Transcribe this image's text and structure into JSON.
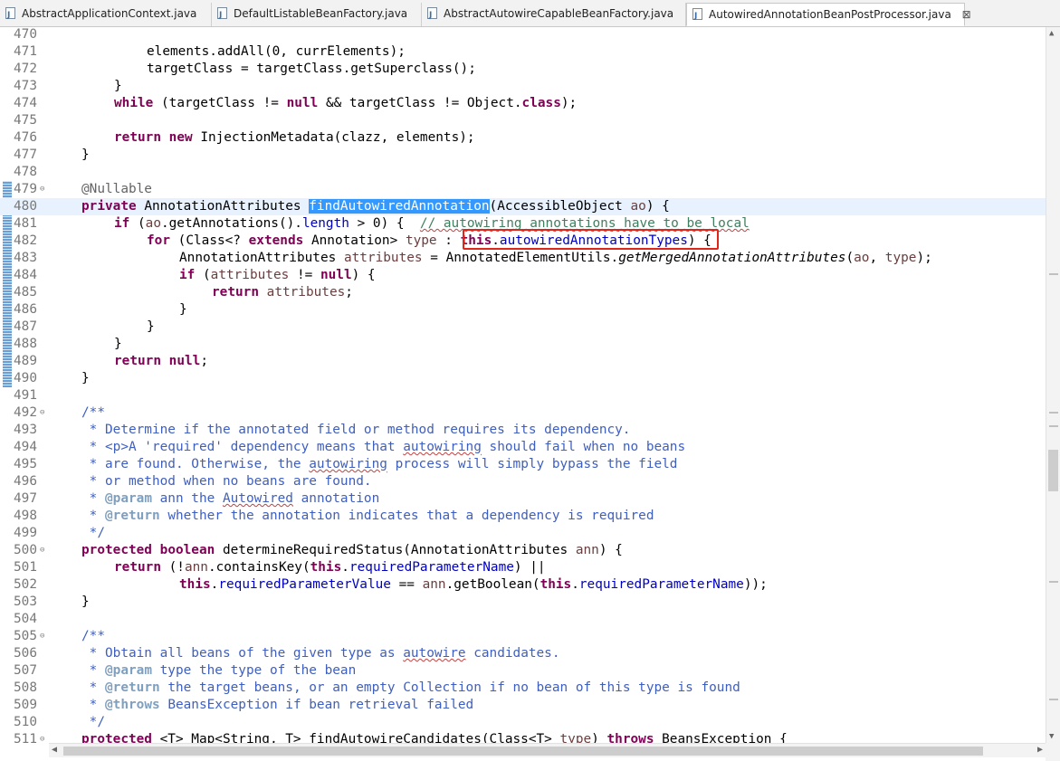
{
  "tabs": [
    {
      "label": "AbstractApplicationContext.java",
      "active": false
    },
    {
      "label": "DefaultListableBeanFactory.java",
      "active": false
    },
    {
      "label": "AbstractAutowireCapableBeanFactory.java",
      "active": false
    },
    {
      "label": "AutowiredAnnotationBeanPostProcessor.java",
      "active": true
    }
  ],
  "tab_close_glyph": "⊠",
  "line_numbers": [
    "470",
    "471",
    "472",
    "473",
    "474",
    "475",
    "476",
    "477",
    "478",
    "479",
    "480",
    "481",
    "482",
    "483",
    "484",
    "485",
    "486",
    "487",
    "488",
    "489",
    "490",
    "491",
    "492",
    "493",
    "494",
    "495",
    "496",
    "497",
    "498",
    "499",
    "500",
    "501",
    "502",
    "503",
    "504",
    "505",
    "506",
    "507",
    "508",
    "509",
    "510",
    "511"
  ],
  "code": {
    "l471": [
      "elements.addAll(0, currElements);"
    ],
    "l472": [
      "targetClass = targetClass.getSuperclass();"
    ],
    "l473": [
      "}"
    ],
    "l474": [
      "while",
      " (targetClass != ",
      "null",
      " && targetClass != Object.",
      "class",
      ");"
    ],
    "l476": [
      "return",
      " ",
      "new",
      " InjectionMetadata(clazz, elements);"
    ],
    "l477": [
      "}"
    ],
    "l479": [
      "@Nullable"
    ],
    "l480": [
      "private",
      " AnnotationAttributes ",
      "findAutowiredAnnotation",
      "(AccessibleObject ",
      "ao",
      ") {"
    ],
    "l481": [
      "if",
      " (",
      "ao",
      ".getAnnotations().",
      "length",
      " > 0) {  ",
      "// autowiring annotations have to be local"
    ],
    "l482": [
      "for",
      " (Class<? ",
      "extends",
      " Annotation> ",
      "type",
      " : ",
      "this",
      ".",
      "autowiredAnnotationTypes",
      ") {"
    ],
    "l483": [
      "AnnotationAttributes ",
      "attributes",
      " = AnnotatedElementUtils.",
      "getMergedAnnotationAttributes",
      "(",
      "ao",
      ", ",
      "type",
      ");"
    ],
    "l484": [
      "if",
      " (",
      "attributes",
      " != ",
      "null",
      ") {"
    ],
    "l485": [
      "return",
      " ",
      "attributes",
      ";"
    ],
    "l486": [
      "}"
    ],
    "l487": [
      "}"
    ],
    "l488": [
      "}"
    ],
    "l489": [
      "return",
      " ",
      "null",
      ";"
    ],
    "l490": [
      "}"
    ],
    "l492": [
      "/**"
    ],
    "l493": [
      " * Determine if the annotated field or method requires its dependency."
    ],
    "l494": [
      " * <p>A 'required' dependency means that ",
      "autowiring",
      " should fail when no beans"
    ],
    "l495": [
      " * are found. Otherwise, the ",
      "autowiring",
      " process will simply bypass the field"
    ],
    "l496": [
      " * or method when no beans are found."
    ],
    "l497": [
      " * ",
      "@param",
      " ann the ",
      "Autowired",
      " annotation"
    ],
    "l498": [
      " * ",
      "@return",
      " whether the annotation indicates that a dependency is required"
    ],
    "l499": [
      " */"
    ],
    "l500": [
      "protected",
      " ",
      "boolean",
      " determineRequiredStatus(AnnotationAttributes ",
      "ann",
      ") {"
    ],
    "l501": [
      "return",
      " (!",
      "ann",
      ".containsKey(",
      "this",
      ".",
      "requiredParameterName",
      ") ||"
    ],
    "l502": [
      "this",
      ".",
      "requiredParameterValue",
      " == ",
      "ann",
      ".getBoolean(",
      "this",
      ".",
      "requiredParameterName",
      "));"
    ],
    "l503": [
      "}"
    ],
    "l505": [
      "/**"
    ],
    "l506": [
      " * Obtain all beans of the given type as ",
      "autowire",
      " candidates."
    ],
    "l507": [
      " * ",
      "@param",
      " type the type of the bean"
    ],
    "l508": [
      " * ",
      "@return",
      " the target beans, or an empty Collection if no bean of this type is found"
    ],
    "l509": [
      " * ",
      "@throws",
      " BeansException if bean retrieval failed"
    ],
    "l510": [
      " */"
    ],
    "l511": [
      "protected",
      " <T> Map<String, T> findAutowireCandidates(Class<T> ",
      "type",
      ") ",
      "throws",
      " BeansException {"
    ]
  },
  "fold_marker": "⊖",
  "colors": {
    "keyword": "#7f0055",
    "comment": "#3f7f5f",
    "javadoc": "#3f5fbf",
    "field": "#0000c0",
    "selection": "#3399ff",
    "current_line": "#e8f2fe",
    "highlight_box": "#e0261b"
  },
  "scroll_glyphs": {
    "up": "▲",
    "down": "▼",
    "left": "◀",
    "right": "▶"
  }
}
